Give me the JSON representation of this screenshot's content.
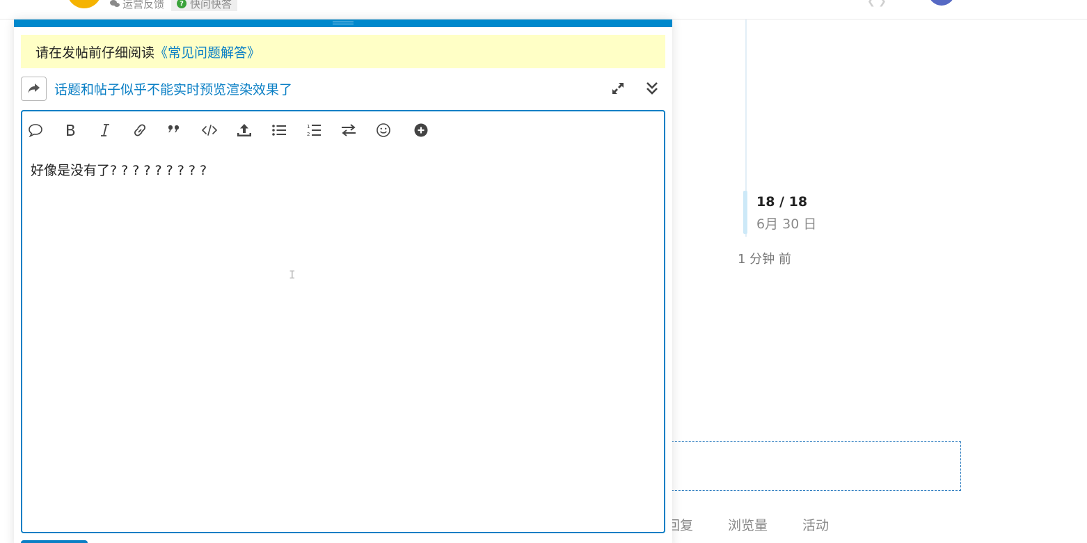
{
  "header": {
    "crumbs": [
      {
        "label": "运营反馈",
        "icon": "chat-bubbles-icon"
      },
      {
        "label": "快问快答",
        "icon": "question-circle-icon",
        "color": "#3aa33a"
      }
    ]
  },
  "composer": {
    "notice": {
      "prefix": "请在发帖前仔细阅读",
      "link": "《常见问题解答》"
    },
    "reply_to_title": "话题和帖子似乎不能实时预览渲染效果了",
    "toolbar": [
      {
        "icon": "quote-bubble-icon"
      },
      {
        "icon": "bold-icon"
      },
      {
        "icon": "italic-icon"
      },
      {
        "icon": "link-icon"
      },
      {
        "icon": "blockquote-icon"
      },
      {
        "icon": "code-icon"
      },
      {
        "icon": "upload-icon"
      },
      {
        "icon": "bullet-list-icon"
      },
      {
        "icon": "numbered-list-icon"
      },
      {
        "icon": "toggle-direction-icon"
      },
      {
        "icon": "emoji-icon"
      },
      {
        "icon": "add-circle-icon"
      }
    ],
    "body_text": "好像是没有了? ? ? ? ? ? ? ? ?",
    "accent_color": "#0088cc",
    "notice_bg": "#ffffc6"
  },
  "timeline": {
    "count": "18 / 18",
    "date": "6月 30 日",
    "ago": "1 分钟 前"
  },
  "stats": {
    "replies": "回复",
    "views": "浏览量",
    "activity": "活动"
  }
}
